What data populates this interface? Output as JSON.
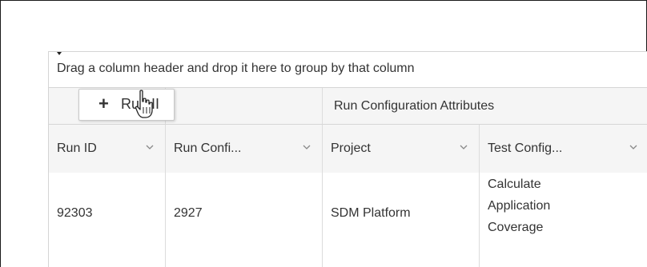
{
  "group_panel": {
    "hint": "Drag a column header and drop it here to group by that column"
  },
  "column_group": {
    "title": "Run Configuration Attributes"
  },
  "columns": [
    {
      "label": "Run ID"
    },
    {
      "label": "Run Confi..."
    },
    {
      "label": "Project"
    },
    {
      "label": "Test Config..."
    }
  ],
  "rows": [
    {
      "run_id": "92303",
      "run_config": "2927",
      "project": "SDM Platform",
      "test_config": [
        "Calculate",
        "Application",
        "Coverage"
      ]
    }
  ],
  "drag_chip": {
    "plus": "+",
    "label": "Run II"
  },
  "icons": {
    "column_menu": "chevron-down-icon",
    "cursor": "hand-pointer-icon"
  }
}
